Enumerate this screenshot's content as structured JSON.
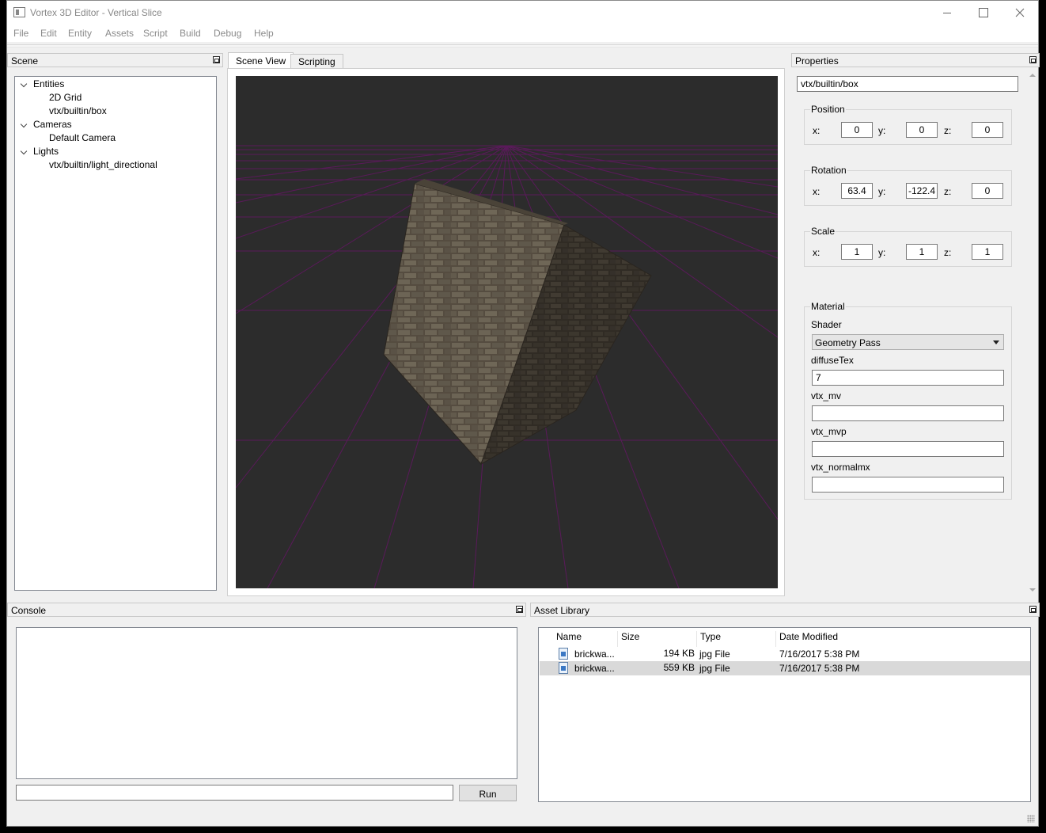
{
  "window": {
    "title": "Vortex 3D Editor - Vertical Slice"
  },
  "menu": [
    "File",
    "Edit",
    "Entity",
    "Assets",
    "Script",
    "Build",
    "Debug",
    "Help"
  ],
  "scene_panel": {
    "title": "Scene",
    "tree": [
      {
        "label": "Entities",
        "children": [
          "2D Grid",
          "vtx/builtin/box"
        ]
      },
      {
        "label": "Cameras",
        "children": [
          "Default Camera"
        ]
      },
      {
        "label": "Lights",
        "children": [
          "vtx/builtin/light_directional"
        ]
      }
    ]
  },
  "tabs": {
    "scene_view": "Scene View",
    "scripting": "Scripting"
  },
  "viewport": {
    "background": "#2c2c2c",
    "grid_color": "#5a1a5a"
  },
  "properties": {
    "title": "Properties",
    "name_value": "vtx/builtin/box",
    "position": {
      "title": "Position",
      "x_label": "x:",
      "y_label": "y:",
      "z_label": "z:",
      "x": "0",
      "y": "0",
      "z": "0"
    },
    "rotation": {
      "title": "Rotation",
      "x_label": "x:",
      "y_label": "y:",
      "z_label": "z:",
      "x": "63.4",
      "y": "-122.4",
      "z": "0"
    },
    "scale": {
      "title": "Scale",
      "x_label": "x:",
      "y_label": "y:",
      "z_label": "z:",
      "x": "1",
      "y": "1",
      "z": "1"
    },
    "material": {
      "title": "Material",
      "shader_label": "Shader",
      "shader_value": "Geometry Pass",
      "fields": [
        {
          "label": "diffuseTex",
          "value": "7"
        },
        {
          "label": "vtx_mv",
          "value": ""
        },
        {
          "label": "vtx_mvp",
          "value": ""
        },
        {
          "label": "vtx_normalmx",
          "value": ""
        }
      ]
    }
  },
  "console": {
    "title": "Console",
    "input_value": "",
    "run_label": "Run"
  },
  "asset_library": {
    "title": "Asset Library",
    "columns": [
      "Name",
      "Size",
      "Type",
      "Date Modified"
    ],
    "rows": [
      {
        "name": "brickwa...",
        "size": "194 KB",
        "type": "jpg File",
        "date": "7/16/2017 5:38 PM",
        "selected": false
      },
      {
        "name": "brickwa...",
        "size": "559 KB",
        "type": "jpg File",
        "date": "7/16/2017 5:38 PM",
        "selected": true
      }
    ]
  }
}
